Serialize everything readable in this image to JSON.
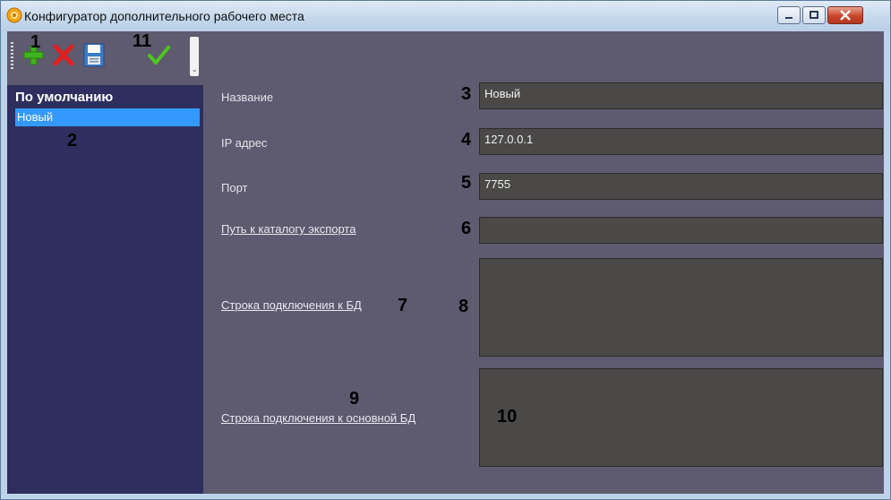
{
  "window": {
    "title": "Конфигуратор дополнительного рабочего места",
    "icon": "app-gear-icon"
  },
  "toolbar": {
    "buttons": [
      {
        "name": "add-button",
        "icon": "plus-icon",
        "color": "#3fb41d"
      },
      {
        "name": "delete-button",
        "icon": "cross-icon",
        "color": "#e02020"
      },
      {
        "name": "save-button",
        "icon": "floppy-icon",
        "color": "#3a7cc7"
      },
      {
        "name": "apply-button",
        "icon": "check-icon",
        "color": "#4cc71d"
      }
    ],
    "overflow_glyph": "⌄"
  },
  "sidebar": {
    "header": "По умолчанию",
    "items": [
      {
        "label": "Новый",
        "selected": true
      }
    ]
  },
  "form": {
    "name_label": "Название",
    "name_value": "Новый",
    "ip_label": "IP адрес",
    "ip_value": "127.0.0.1",
    "port_label": "Порт",
    "port_value": "7755",
    "export_label": "Путь к каталогу экспорта",
    "export_value": "",
    "db_label": "Строка подключения к БД",
    "db_value": "",
    "main_db_label": "Строка подключения к основной БД",
    "main_db_value": ""
  },
  "markers": {
    "m1": "1",
    "m11": "11",
    "m2": "2",
    "m3": "3",
    "m4": "4",
    "m5": "5",
    "m6": "6",
    "m7": "7",
    "m8": "8",
    "m9": "9",
    "m10": "10"
  },
  "colors": {
    "panel": "#5e5a6f",
    "sidebar": "#2e2f5e",
    "selection": "#3399ff",
    "field": "#4a4948"
  }
}
